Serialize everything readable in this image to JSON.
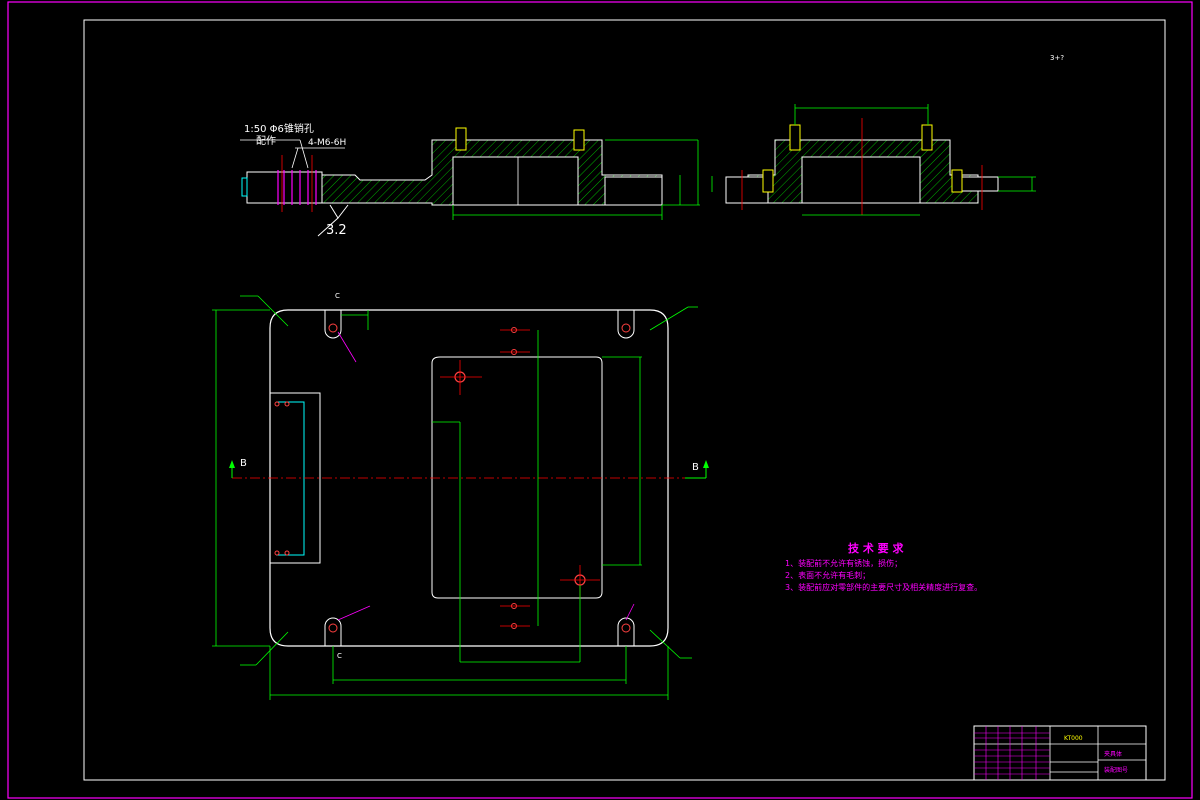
{
  "drawing": {
    "top_right_note": "3+?",
    "section_label_left": "B",
    "section_label_right": "B",
    "corner_label_c_top": "C",
    "corner_label_c_bottom": "C"
  },
  "side_view": {
    "taper_note_line1": "1:50 Φ6锥销孔",
    "taper_note_line2": "配作",
    "thread_note": "4-M6-6H",
    "roughness": "3.2"
  },
  "technical_requirements": {
    "title": "技 术 要 求",
    "items": [
      "1、装配前不允许有锈蚀，损伤；",
      "2、表面不允许有毛刺；",
      "3、装配前应对零部件的主要尺寸及相关精度进行复查。"
    ]
  },
  "title_block": {
    "drawing_number": "KT000",
    "part_name": "夹具体",
    "material_note": "装配图号"
  },
  "colors": {
    "border": "#ff00ff",
    "outline": "#ffffff",
    "hatch": "#00c000",
    "dimension": "#00ff00",
    "centerline": "#ff0000",
    "text_magenta": "#ff00ff",
    "text_yellow": "#ffff00"
  }
}
